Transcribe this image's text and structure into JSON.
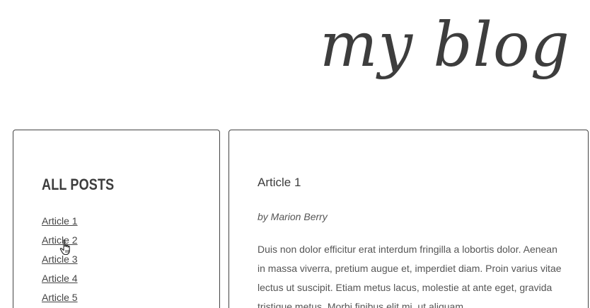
{
  "site": {
    "logo_text": "my blog"
  },
  "sidebar": {
    "heading": "ALL POSTS",
    "posts": [
      "Article 1",
      "Article 2",
      "Article 3",
      "Article 4",
      "Article 5"
    ]
  },
  "article": {
    "title": "Article 1",
    "byline": "by Marion Berry",
    "body": "Duis non dolor efficitur erat interdum fringilla a lobortis dolor. Aenean in massa viverra, pretium augue et, imperdiet diam. Proin varius vitae lectus ut suscipit. Etiam metus lacus, molestie at ante eget, gravida tristique metus. Morbi finibus elit mi, ut aliquam"
  },
  "cursor": {
    "icon": "hand-pointer-icon"
  }
}
